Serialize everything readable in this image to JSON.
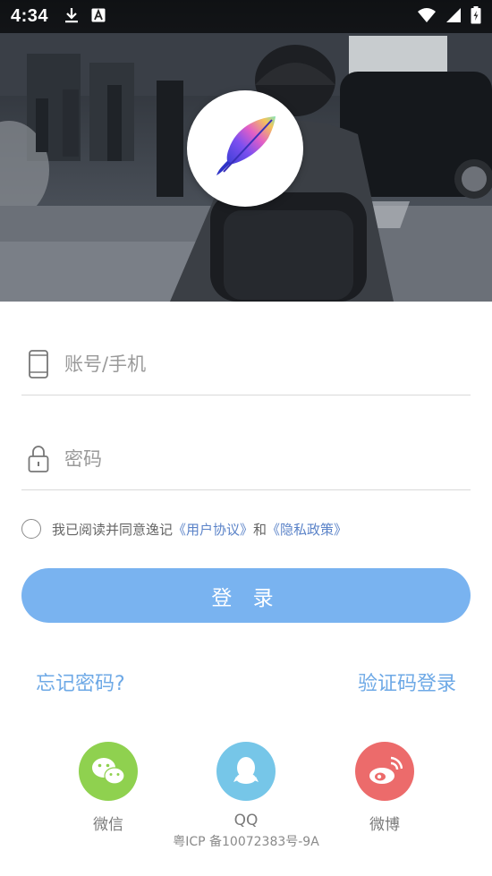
{
  "status_bar": {
    "time": "4:34",
    "left_icons": [
      "download-icon",
      "text-a-icon"
    ],
    "right_icons": [
      "wifi-icon",
      "signal-icon",
      "battery-icon"
    ]
  },
  "hero": {
    "logo_icon": "feather-logo-icon"
  },
  "form": {
    "account": {
      "placeholder": "账号/手机",
      "value": "",
      "icon": "phone-icon"
    },
    "password": {
      "placeholder": "密码",
      "value": "",
      "icon": "lock-icon"
    }
  },
  "agreement": {
    "prefix": "我已阅读并同意逸记",
    "user_agreement": "《用户协议》",
    "and": "和",
    "privacy_policy": "《隐私政策》"
  },
  "login_button": "登 录",
  "links": {
    "forgot_password": "忘记密码?",
    "sms_login": "验证码登录"
  },
  "social": [
    {
      "label": "微信",
      "icon": "wechat-icon",
      "color": "#8fd14f"
    },
    {
      "label": "QQ",
      "icon": "qq-icon",
      "color": "#76c6e8"
    },
    {
      "label": "微博",
      "icon": "weibo-icon",
      "color": "#ec6b6b"
    }
  ],
  "icp": "粤ICP 备10072383号-9A",
  "colors": {
    "accent": "#79b3f0",
    "link": "#6ea9e6",
    "agreement_link": "#5b83c8"
  }
}
